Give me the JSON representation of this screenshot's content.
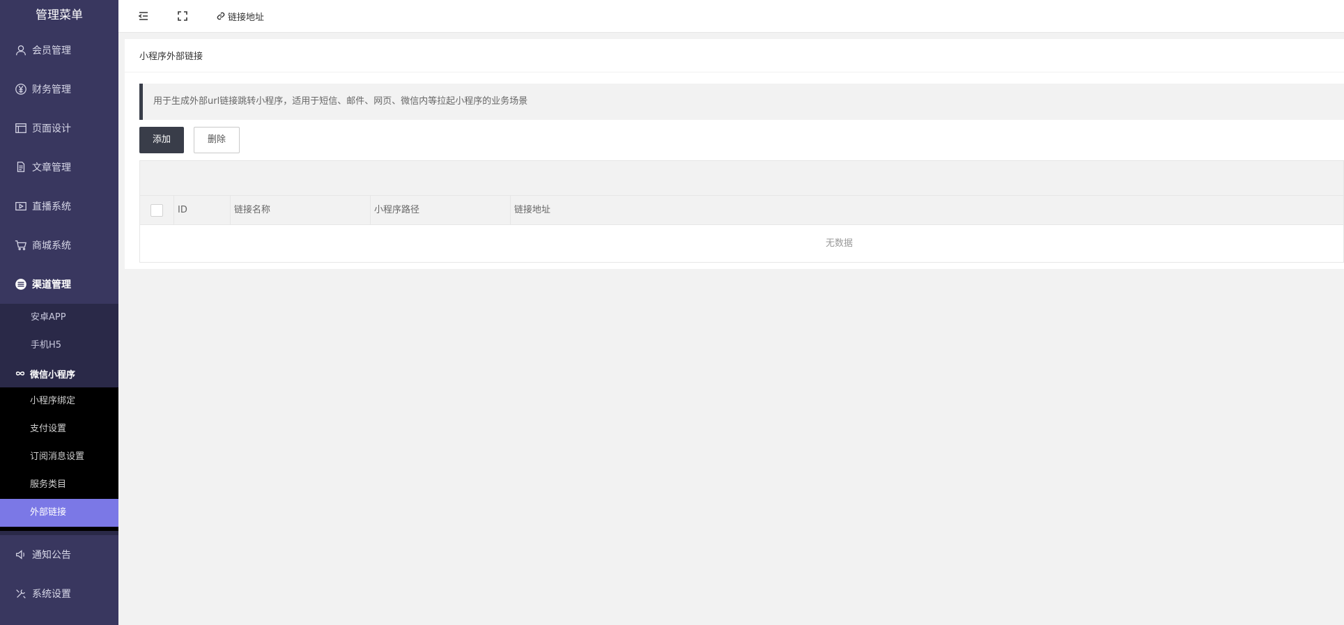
{
  "sidebar": {
    "title": "管理菜单",
    "top_items": [
      {
        "label": "会员管理",
        "icon": "user-icon"
      },
      {
        "label": "财务管理",
        "icon": "yen-icon"
      },
      {
        "label": "页面设计",
        "icon": "layout-icon"
      },
      {
        "label": "文章管理",
        "icon": "document-icon"
      },
      {
        "label": "直播系统",
        "icon": "video-icon"
      },
      {
        "label": "商城系统",
        "icon": "cart-icon"
      },
      {
        "label": "渠道管理",
        "icon": "channel-icon"
      }
    ],
    "channel_sub": [
      {
        "label": "安卓APP"
      },
      {
        "label": "手机H5"
      }
    ],
    "mini_program_group": {
      "label": "微信小程序",
      "icon": "infinity-icon"
    },
    "mini_program_sub": [
      {
        "label": "小程序绑定"
      },
      {
        "label": "支付设置"
      },
      {
        "label": "订阅消息设置"
      },
      {
        "label": "服务类目"
      },
      {
        "label": "外部链接"
      }
    ],
    "bottom_items": [
      {
        "label": "通知公告",
        "icon": "speaker-icon"
      },
      {
        "label": "系统设置",
        "icon": "tools-icon"
      }
    ]
  },
  "topbar": {
    "link_label": "链接地址"
  },
  "panel": {
    "title": "小程序外部链接",
    "notice": "用于生成外部url链接跳转小程序，适用于短信、邮件、网页、微信内等拉起小程序的业务场景",
    "add_label": "添加",
    "delete_label": "删除"
  },
  "table": {
    "columns": [
      "ID",
      "链接名称",
      "小程序路径",
      "链接地址"
    ],
    "empty_text": "无数据"
  },
  "colors": {
    "sidebar_bg": "#39375f",
    "submenu_bg": "#2a2948",
    "active_bg": "#7b78e6",
    "primary_btn": "#393d49"
  }
}
